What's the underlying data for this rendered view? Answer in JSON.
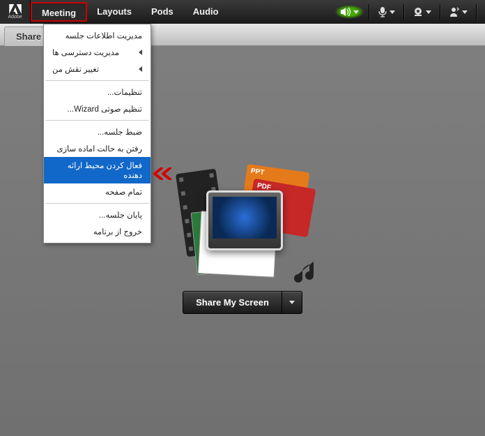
{
  "brand": {
    "label": "Adobe"
  },
  "menubar": {
    "items": [
      {
        "label": "Meeting"
      },
      {
        "label": "Layouts"
      },
      {
        "label": "Pods"
      },
      {
        "label": "Audio"
      }
    ]
  },
  "toolbar": {
    "share_tab": "Share"
  },
  "dropdown": {
    "groups": [
      [
        {
          "label": "مدیریت اطلاعات جلسه",
          "sub": false
        },
        {
          "label": "مدیریت دسترسی ها",
          "sub": true
        },
        {
          "label": "تغییر نقش من",
          "sub": true
        }
      ],
      [
        {
          "label": "تنظیمات...",
          "sub": false
        },
        {
          "label": "تنظیم صوتی Wizard...",
          "sub": false
        }
      ],
      [
        {
          "label": "ضبط جلسه...",
          "sub": false
        },
        {
          "label": "رفتن به حالت اماده سازی",
          "sub": false
        },
        {
          "label": "فعال کردن محیط ارائه دهنده",
          "sub": false,
          "selected": true
        },
        {
          "label": "تمام صفحه",
          "sub": false
        }
      ],
      [
        {
          "label": "پایان جلسه...",
          "sub": false
        },
        {
          "label": "خروج از برنامه",
          "sub": false
        }
      ]
    ]
  },
  "media_labels": {
    "ppt": "PPT",
    "pdf": "PDF"
  },
  "share_button": {
    "label": "Share My Screen"
  }
}
